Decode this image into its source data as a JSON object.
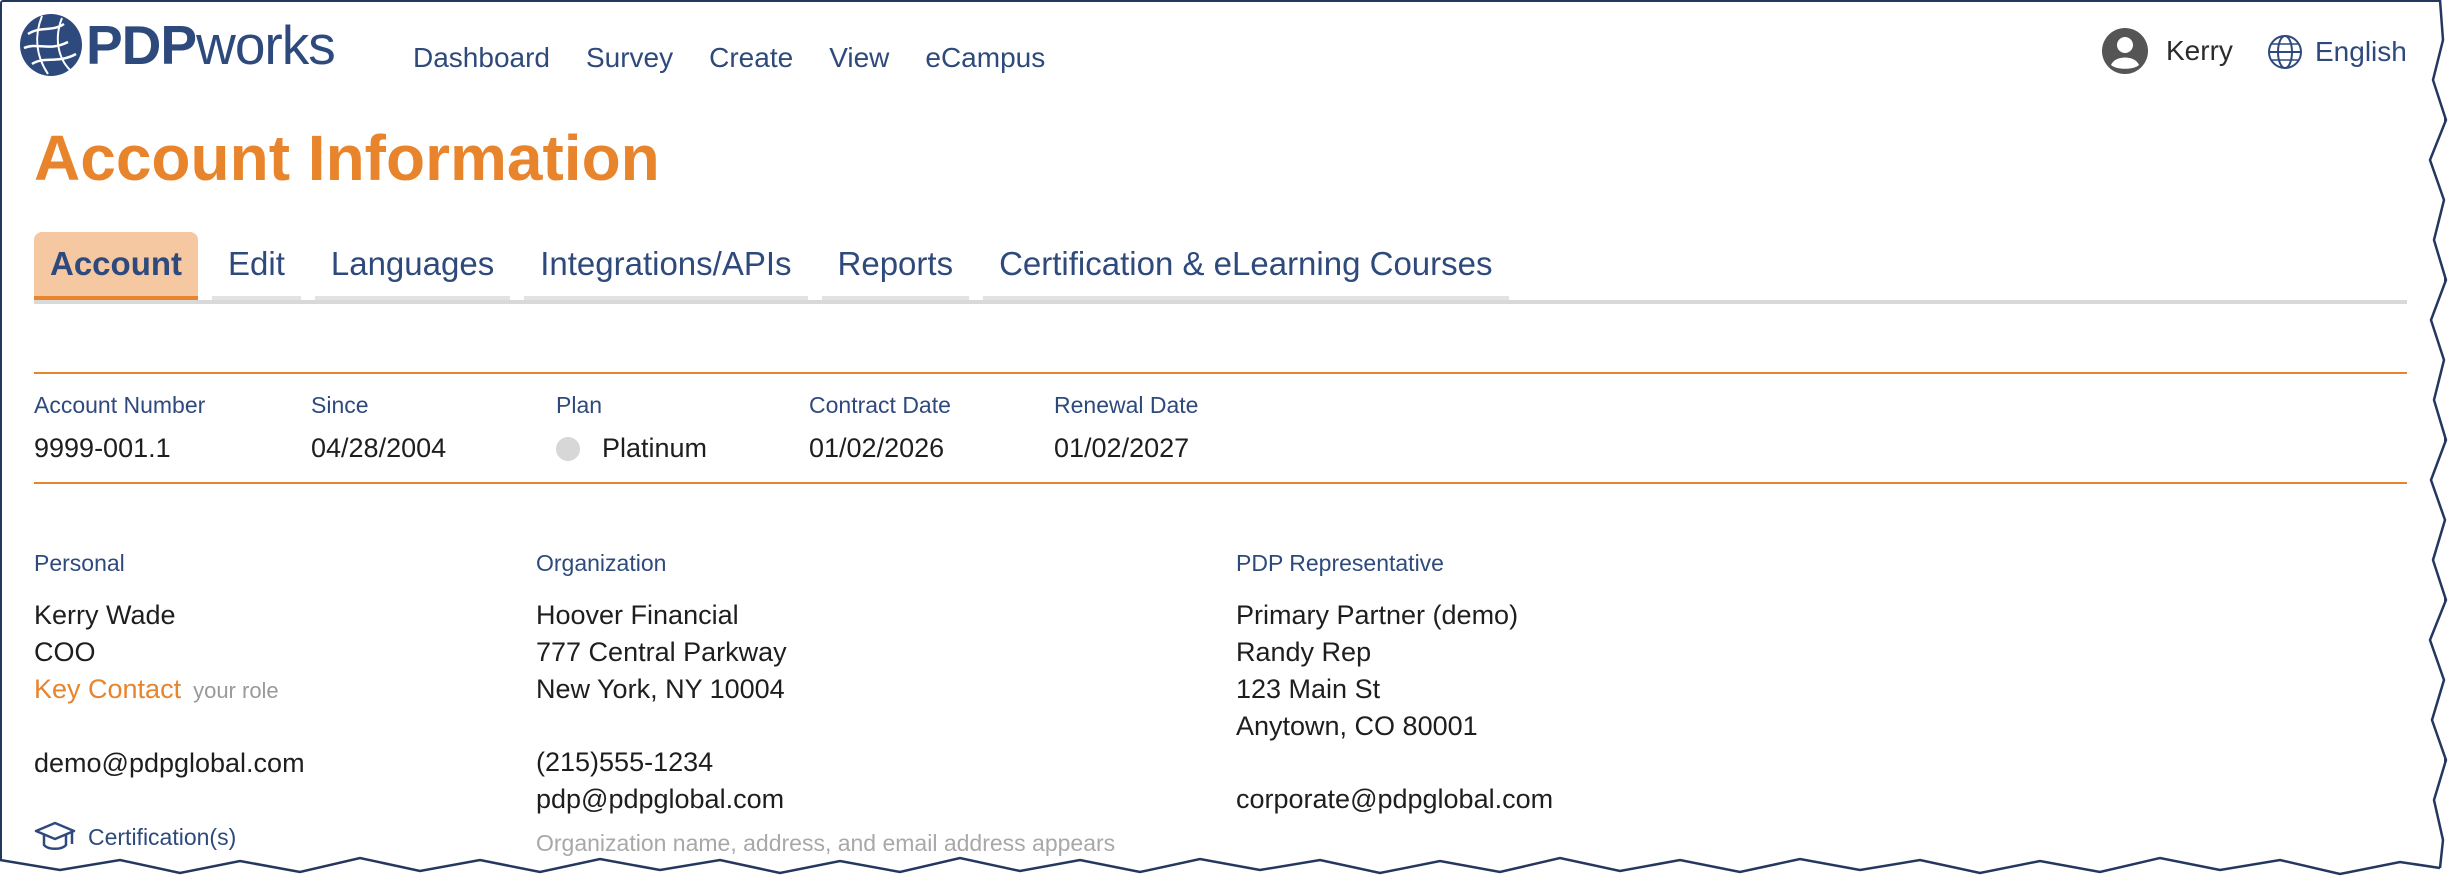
{
  "header": {
    "logo": {
      "pdp": "PDP",
      "works": "works"
    },
    "nav": [
      "Dashboard",
      "Survey",
      "Create",
      "View",
      "eCampus"
    ],
    "user": "Kerry",
    "language": "English"
  },
  "page": {
    "title": "Account Information"
  },
  "tabs": [
    "Account",
    "Edit",
    "Languages",
    "Integrations/APIs",
    "Reports",
    "Certification & eLearning Courses"
  ],
  "active_tab": "Account",
  "summary": {
    "account_number": {
      "label": "Account Number",
      "value": "9999-001.1"
    },
    "since": {
      "label": "Since",
      "value": "04/28/2004"
    },
    "plan": {
      "label": "Plan",
      "value": "Platinum"
    },
    "contract_date": {
      "label": "Contract Date",
      "value": "01/02/2026"
    },
    "renewal_date": {
      "label": "Renewal Date",
      "value": "01/02/2027"
    }
  },
  "personal": {
    "heading": "Personal",
    "name": "Kerry Wade",
    "title": "COO",
    "contact": "Key Contact",
    "role_hint": "your role",
    "email": "demo@pdpglobal.com",
    "certification_link": "Certification(s)"
  },
  "organization": {
    "heading": "Organization",
    "name": "Hoover Financial",
    "address1": "777 Central Parkway",
    "address2": "New York, NY 10004",
    "phone": "(215)555-1234",
    "email": "pdp@pdpglobal.com",
    "note": "Organization name, address, and email address appears"
  },
  "representative": {
    "heading": "PDP Representative",
    "partner": "Primary Partner (demo)",
    "name": "Randy Rep",
    "address1": "123 Main St",
    "address2": "Anytown, CO 80001",
    "email": "corporate@pdpglobal.com"
  },
  "colors": {
    "accent": "#e8842c",
    "brand": "#2e4a7d",
    "active_tab_bg": "#f5c8a1",
    "plan_dot": "#d7d7d7"
  }
}
